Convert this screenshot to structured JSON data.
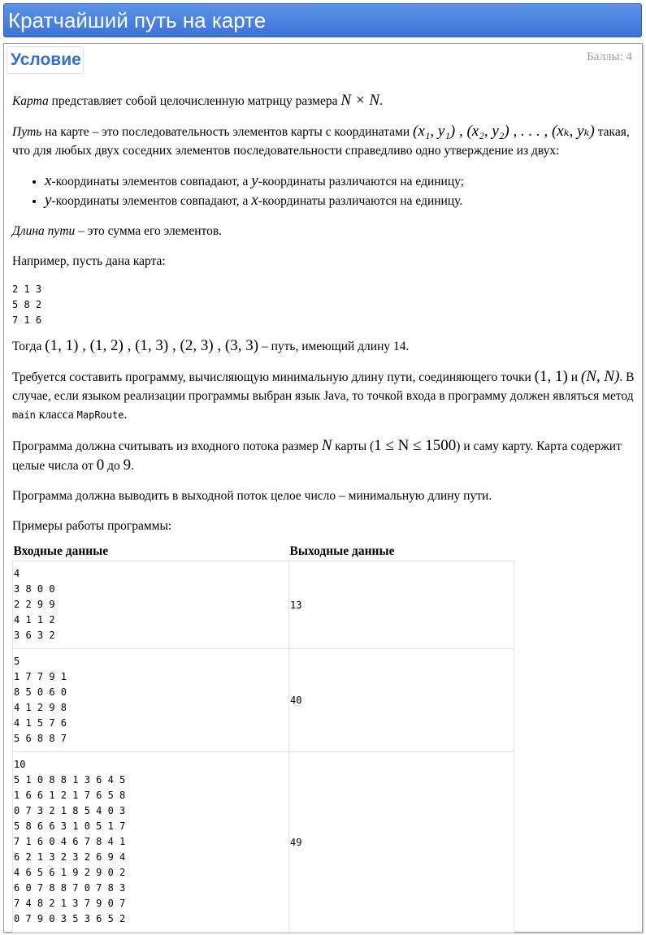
{
  "window": {
    "title": "Кратчайший путь на карте"
  },
  "section": {
    "tab_label": "Условие",
    "score": "Баллы: 4"
  },
  "statement": {
    "p1": {
      "term": "Карта",
      "text": " представляет собой целочисленную матрицу размера ",
      "math": "N × N",
      "end": "."
    },
    "p2": {
      "term": "Путь",
      "text": " на карте – это последовательность элементов карты с координатами ",
      "math": "(x₁, y₁) , (x₂, y₂) , . . . , (xₖ, yₖ)",
      "text2": " такая, что для любых двух соседних элементов последовательности справедливо одно утверждение из двух:"
    },
    "bullets": [
      {
        "var1": "x",
        "text1": "-координаты элементов совпадают, а ",
        "var2": "y",
        "text2": "-координаты различаются на единицу;"
      },
      {
        "var1": "y",
        "text1": "-координаты элементов совпадают, а ",
        "var2": "x",
        "text2": "-координаты различаются на единицу."
      }
    ],
    "p3": {
      "term": "Длина пути",
      "text": " – это сумма его элементов."
    },
    "p4": "Например, пусть дана карта:",
    "example_map": "2 1 3\n5 8 2\n7 1 6",
    "p5": {
      "text": "Тогда ",
      "math": "(1, 1) , (1, 2) , (1, 3) , (2, 3) , (3, 3)",
      "text2": " – путь, имеющий длину 14."
    },
    "p6": {
      "text": "Требуется составить программу, вычисляющую минимальную длину пути, соединяющего точки ",
      "math1": "(1, 1)",
      "mid": " и ",
      "math2": "(N, N)",
      "text2": ". В случае, если языком реализации программы выбран язык Java, то точкой входа в программу должен являться метод ",
      "code1": "main",
      "text3": " класса ",
      "code2": "MapRoute",
      "end": "."
    },
    "p7": {
      "text": "Программа должна считывать из входного потока размер ",
      "math1": "N",
      "text2": " карты (",
      "math2": "1 ≤ N ≤ 1500",
      "text3": ") и саму карту. Карта содержит целые числа от ",
      "math3": "0",
      "text4": " до ",
      "math4": "9",
      "end": "."
    },
    "p8": "Программа должна выводить в выходной поток целое число – минимальную длину пути.",
    "p9": "Примеры работы программы:"
  },
  "examples": {
    "headers": [
      "Входные данные",
      "Выходные данные"
    ],
    "rows": [
      {
        "input": "4\n3 8 0 0\n2 2 9 9\n4 1 1 2\n3 6 3 2",
        "output": "13"
      },
      {
        "input": "5\n1 7 7 9 1\n8 5 0 6 0\n4 1 2 9 8\n4 1 5 7 6\n5 6 8 8 7",
        "output": "40"
      },
      {
        "input": "10\n5 1 0 8 8 1 3 6 4 5\n1 6 6 1 2 1 7 6 5 8\n0 7 3 2 1 8 5 4 0 3\n5 8 6 6 3 1 0 5 1 7\n7 1 6 0 4 6 7 8 4 1\n6 2 1 3 2 3 2 6 9 4\n4 6 5 6 1 9 2 9 0 2\n6 0 7 8 8 7 0 7 8 3\n7 4 8 2 1 3 7 9 0 7\n0 7 9 0 3 5 3 6 5 2",
        "output": "49"
      }
    ]
  }
}
